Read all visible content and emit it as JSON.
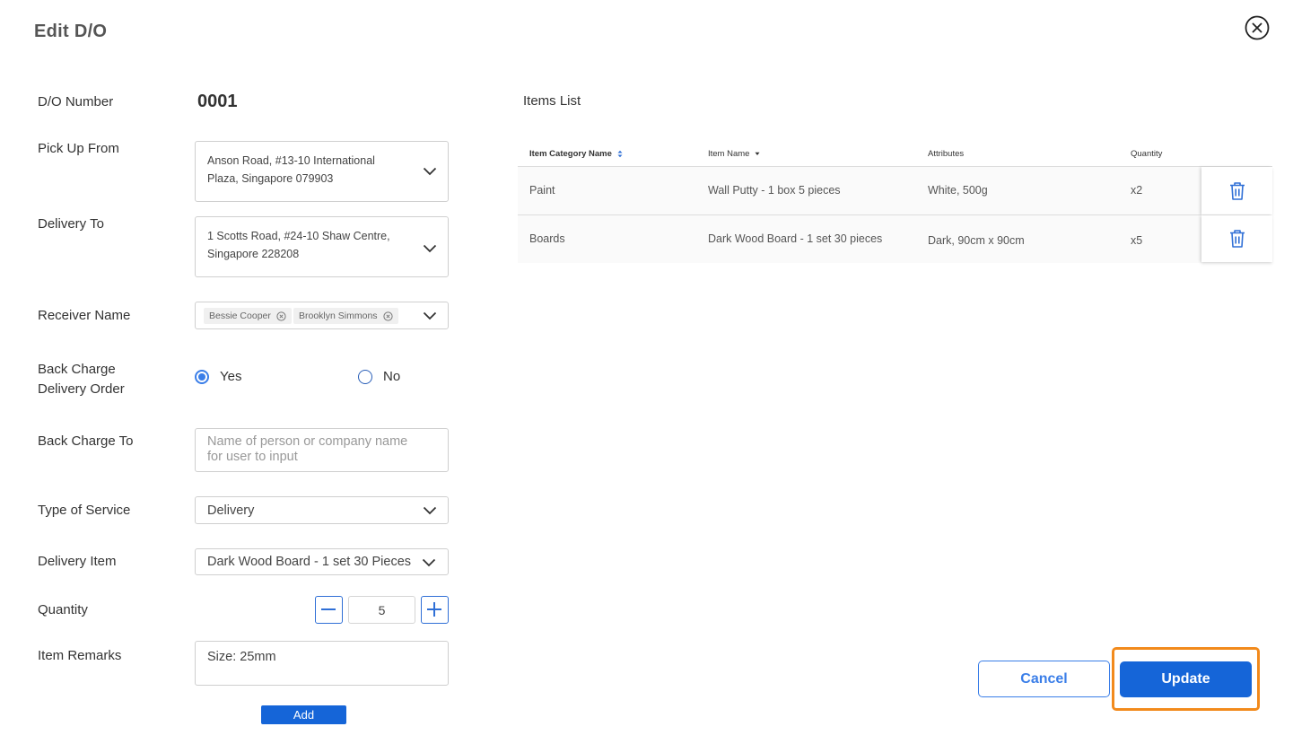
{
  "modal": {
    "title": "Edit  D/O"
  },
  "form": {
    "do_number_label": "D/O Number",
    "do_number_value": "0001",
    "pickup_label": "Pick Up From",
    "pickup_value_line1": "Anson Road, #13-10 International",
    "pickup_value_line2": "Plaza, Singapore 079903",
    "delivery_to_label": "Delivery To",
    "delivery_to_line1": "1 Scotts Road, #24-10 Shaw Centre,",
    "delivery_to_line2": "Singapore 228208",
    "receiver_label": "Receiver Name",
    "receivers": [
      "Bessie Cooper",
      "Brooklyn Simmons"
    ],
    "back_charge_label_line1": "Back Charge",
    "back_charge_label_line2": "Delivery Order",
    "back_charge_yes": "Yes",
    "back_charge_no": "No",
    "back_charge_selected": "Yes",
    "back_charge_to_label": "Back Charge To",
    "back_charge_to_placeholder_line1": "Name of person or company name",
    "back_charge_to_placeholder_line2": "for user to input",
    "service_label": "Type of Service",
    "service_value": "Delivery",
    "delivery_item_label": "Delivery Item",
    "delivery_item_value": "Dark Wood Board - 1 set 30 Pieces",
    "quantity_label": "Quantity",
    "quantity_value": "5",
    "remarks_label": "Item Remarks",
    "remarks_value": "Size: 25mm",
    "add_label": "Add"
  },
  "items": {
    "title": "Items List",
    "headers": [
      "Item Category Name",
      "Item Name",
      "Attributes",
      "Quantity"
    ],
    "rows": [
      {
        "category": "Paint",
        "name": "Wall Putty - 1 box 5 pieces",
        "attributes": "White, 500g",
        "quantity": "x2"
      },
      {
        "category": "Boards",
        "name": "Dark Wood Board - 1 set 30 pieces",
        "attributes": "Dark, 90cm x 90cm",
        "quantity": "x5"
      }
    ]
  },
  "actions": {
    "cancel_label": "Cancel",
    "update_label": "Update"
  },
  "colors": {
    "primary": "#1565d8",
    "accent_border": "#3a7ee8",
    "highlight": "#f28a1c"
  }
}
